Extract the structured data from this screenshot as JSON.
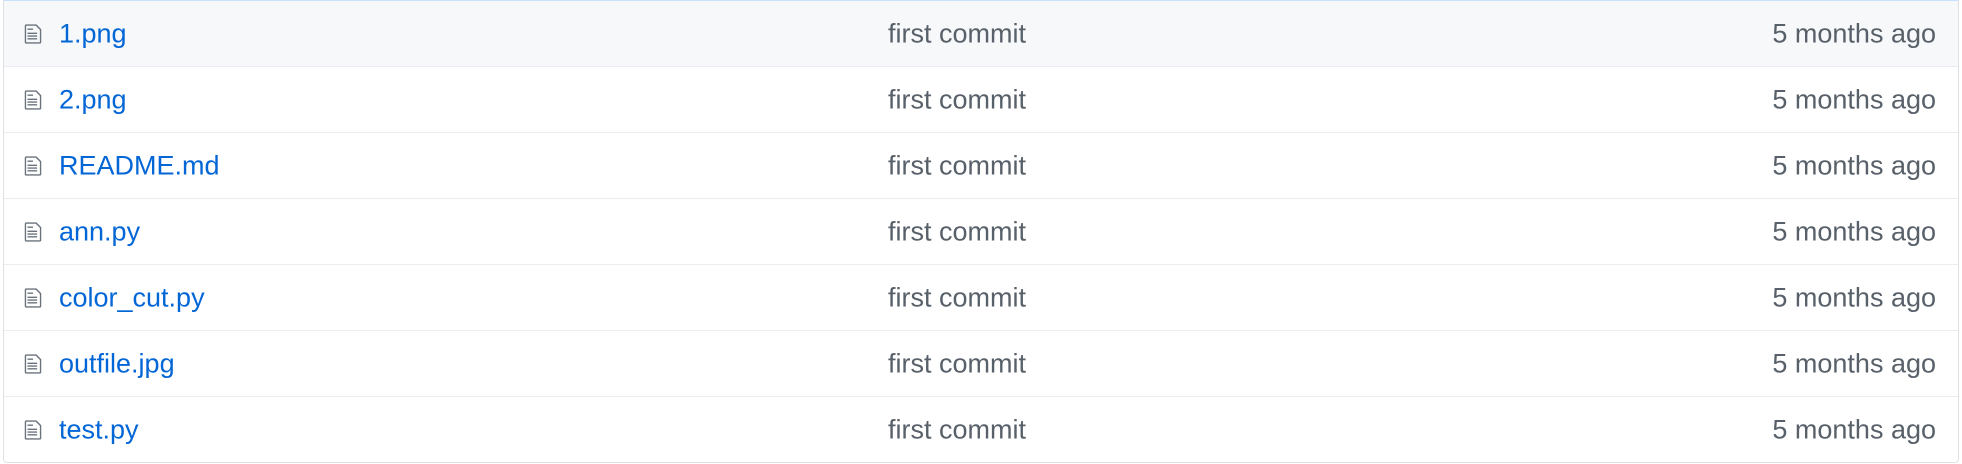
{
  "file_list": {
    "rows": [
      {
        "icon": "file-text-icon",
        "name": "1.png",
        "message": "first commit",
        "age": "5 months ago"
      },
      {
        "icon": "file-text-icon",
        "name": "2.png",
        "message": "first commit",
        "age": "5 months ago"
      },
      {
        "icon": "file-text-icon",
        "name": "README.md",
        "message": "first commit",
        "age": "5 months ago"
      },
      {
        "icon": "file-text-icon",
        "name": "ann.py",
        "message": "first commit",
        "age": "5 months ago"
      },
      {
        "icon": "file-text-icon",
        "name": "color_cut.py",
        "message": "first commit",
        "age": "5 months ago"
      },
      {
        "icon": "file-text-icon",
        "name": "outfile.jpg",
        "message": "first commit",
        "age": "5 months ago"
      },
      {
        "icon": "file-text-icon",
        "name": "test.py",
        "message": "first commit",
        "age": "5 months ago"
      }
    ]
  },
  "colors": {
    "link": "#0366d6",
    "muted_text": "#586069",
    "border": "#eaecef",
    "header_row_bg": "#f6f8fa"
  }
}
